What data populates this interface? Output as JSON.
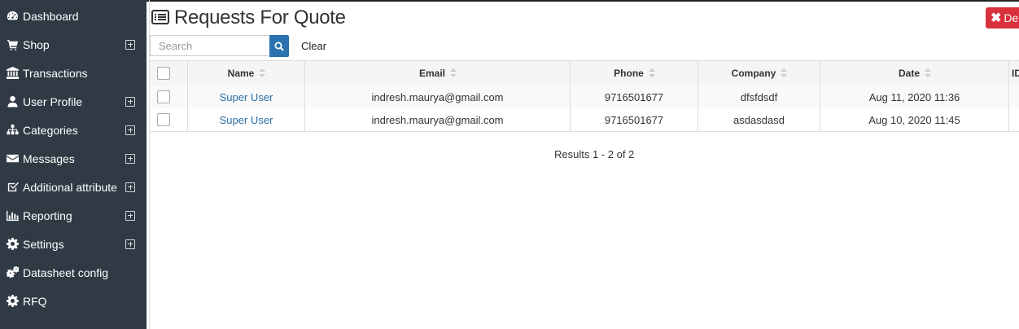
{
  "sidebar": {
    "items": [
      {
        "label": "Dashboard",
        "icon": "dashboard-icon",
        "expandable": false
      },
      {
        "label": "Shop",
        "icon": "cart-icon",
        "expandable": true
      },
      {
        "label": "Transactions",
        "icon": "bank-icon",
        "expandable": false
      },
      {
        "label": "User Profile",
        "icon": "user-icon",
        "expandable": true
      },
      {
        "label": "Categories",
        "icon": "sitemap-icon",
        "expandable": true
      },
      {
        "label": "Messages",
        "icon": "envelope-icon",
        "expandable": true
      },
      {
        "label": "Additional attribute",
        "icon": "checkbox-icon",
        "expandable": true
      },
      {
        "label": "Reporting",
        "icon": "bar-chart-icon",
        "expandable": true
      },
      {
        "label": "Settings",
        "icon": "gear-icon",
        "expandable": true
      },
      {
        "label": "Datasheet config",
        "icon": "gears-icon",
        "expandable": false
      },
      {
        "label": "RFQ",
        "icon": "gear-icon",
        "expandable": false
      }
    ]
  },
  "header": {
    "title": "Requests For Quote",
    "delete_label": "Del"
  },
  "search": {
    "placeholder": "Search",
    "value": "",
    "clear_label": "Clear"
  },
  "table": {
    "columns": [
      "Name",
      "Email",
      "Phone",
      "Company",
      "Date",
      "ID"
    ],
    "rows": [
      {
        "name": "Super User",
        "email": "indresh.maurya@gmail.com",
        "phone": "9716501677",
        "company": "dfsfdsdf",
        "date": "Aug 11, 2020 11:36"
      },
      {
        "name": "Super User",
        "email": "indresh.maurya@gmail.com",
        "phone": "9716501677",
        "company": "asdasdasd",
        "date": "Aug 10, 2020 11:45"
      }
    ]
  },
  "pagination": {
    "results_text": "Results 1 - 2 of 2"
  },
  "colors": {
    "sidebar_bg": "#2f3a44",
    "link": "#2a6ea6",
    "search_button": "#2a73ae",
    "delete_button": "#d9303b"
  }
}
